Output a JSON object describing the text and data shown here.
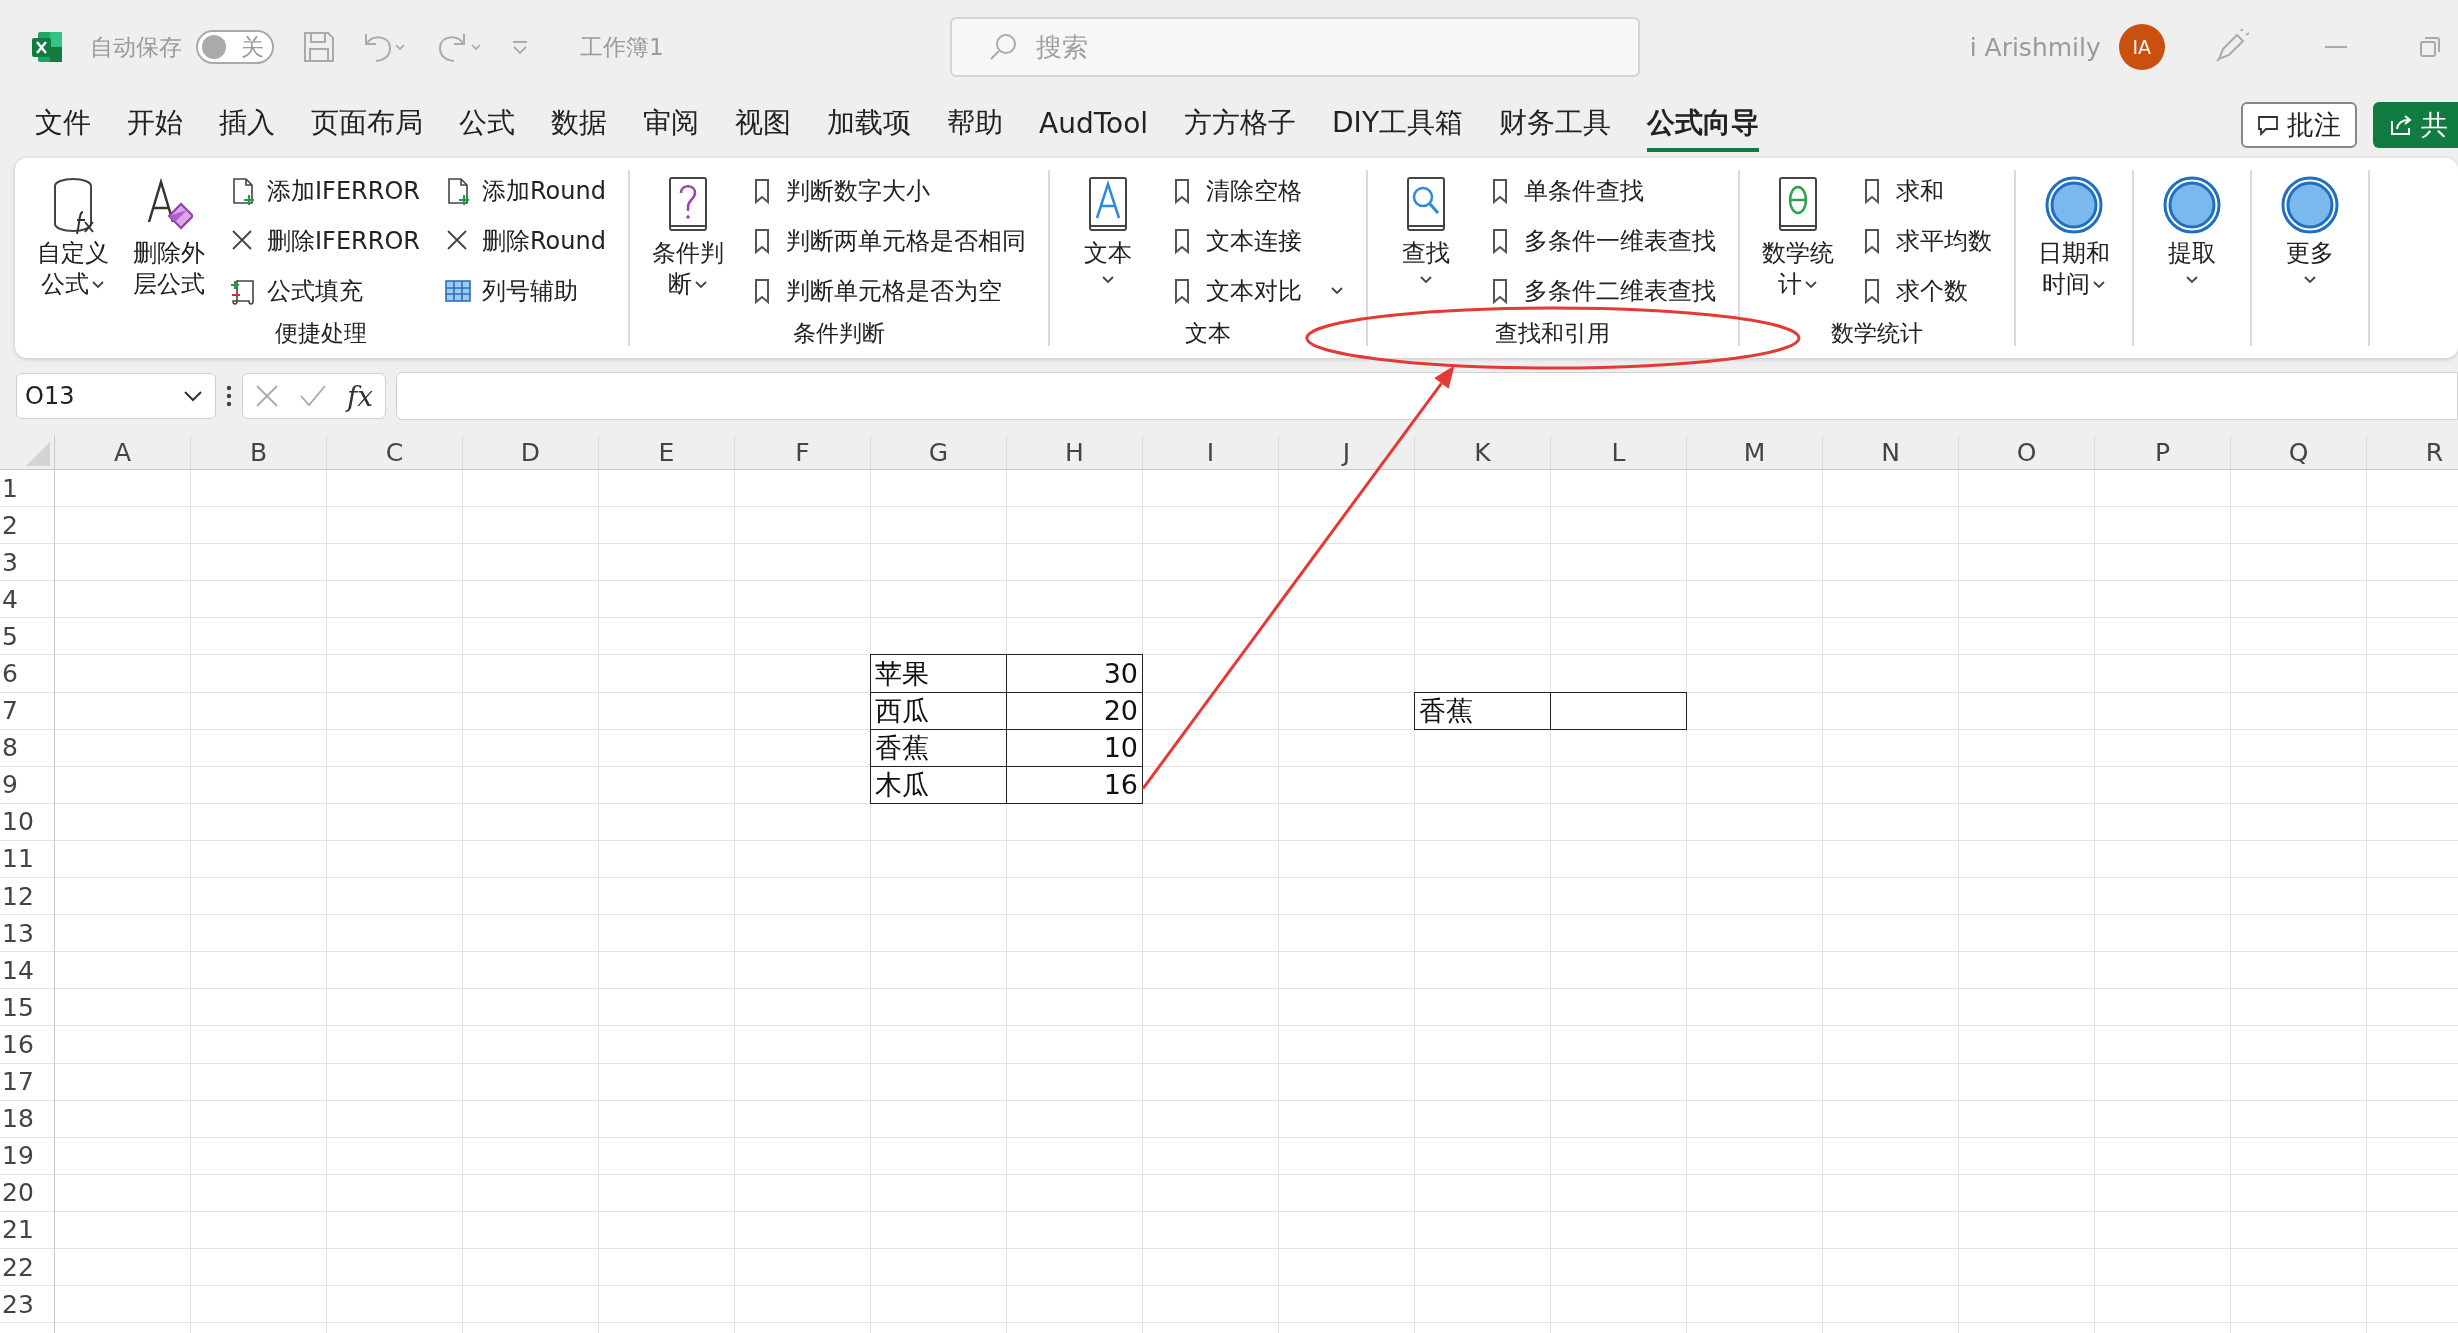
{
  "title_bar": {
    "autosave_label": "自动保存",
    "autosave": {
      "on": false,
      "text": "关"
    },
    "workbook": "工作簿1",
    "search_placeholder": "搜索",
    "user": "i Arishmily",
    "avatar": "IA"
  },
  "menu_tabs": [
    {
      "label": "文件",
      "selected": false
    },
    {
      "label": "开始",
      "selected": false
    },
    {
      "label": "插入",
      "selected": false
    },
    {
      "label": "页面布局",
      "selected": false
    },
    {
      "label": "公式",
      "selected": false
    },
    {
      "label": "数据",
      "selected": false
    },
    {
      "label": "审阅",
      "selected": false
    },
    {
      "label": "视图",
      "selected": false
    },
    {
      "label": "加载项",
      "selected": false
    },
    {
      "label": "帮助",
      "selected": false
    },
    {
      "label": "AudTool",
      "selected": false
    },
    {
      "label": "方方格子",
      "selected": false
    },
    {
      "label": "DIY工具箱",
      "selected": false
    },
    {
      "label": "财务工具",
      "selected": false
    },
    {
      "label": "公式向导",
      "selected": true
    }
  ],
  "comments_button": "批注",
  "share_button": "共",
  "ribbon": {
    "groups": [
      {
        "label": "便捷处理",
        "circled": false,
        "items": [
          {
            "kind": "large",
            "label": "自定义公式",
            "dropdown": true
          },
          {
            "kind": "large",
            "label": "删除外层公式",
            "dropdown": false
          },
          {
            "kind": "stack",
            "entries": [
              {
                "label": "添加IFERROR",
                "dropdown": false
              },
              {
                "label": "删除IFERROR",
                "dropdown": false
              },
              {
                "label": "公式填充",
                "dropdown": false
              }
            ]
          },
          {
            "kind": "stack",
            "entries": [
              {
                "label": "添加Round",
                "dropdown": false
              },
              {
                "label": "删除Round",
                "dropdown": false
              },
              {
                "label": "列号辅助",
                "dropdown": false
              }
            ]
          }
        ]
      },
      {
        "label": "条件判断",
        "circled": false,
        "items": [
          {
            "kind": "large",
            "label": "条件判断",
            "dropdown": true
          },
          {
            "kind": "stack",
            "entries": [
              {
                "label": "判断数字大小",
                "dropdown": false
              },
              {
                "label": "判断两单元格是否相同",
                "dropdown": false
              },
              {
                "label": "判断单元格是否为空",
                "dropdown": false
              }
            ]
          }
        ]
      },
      {
        "label": "文本",
        "circled": false,
        "items": [
          {
            "kind": "large",
            "label": "文本",
            "dropdown": true
          },
          {
            "kind": "stack",
            "entries": [
              {
                "label": "清除空格",
                "dropdown": false
              },
              {
                "label": "文本连接",
                "dropdown": false
              },
              {
                "label": "文本对比",
                "dropdown": true
              }
            ]
          }
        ]
      },
      {
        "label": "查找和引用",
        "circled": true,
        "items": [
          {
            "kind": "large",
            "label": "查找",
            "dropdown": true
          },
          {
            "kind": "stack",
            "entries": [
              {
                "label": "单条件查找",
                "dropdown": false
              },
              {
                "label": "多条件一维表查找",
                "dropdown": false
              },
              {
                "label": "多条件二维表查找",
                "dropdown": false
              }
            ]
          }
        ]
      },
      {
        "label": "数学统计",
        "circled": false,
        "items": [
          {
            "kind": "large",
            "label": "数学统计",
            "dropdown": true
          },
          {
            "kind": "stack",
            "entries": [
              {
                "label": "求和",
                "dropdown": false
              },
              {
                "label": "求平均数",
                "dropdown": false
              },
              {
                "label": "求个数",
                "dropdown": false
              }
            ]
          }
        ]
      },
      {
        "circled": false,
        "items": [
          {
            "kind": "large",
            "label": "日期和时间",
            "dropdown": true
          }
        ]
      },
      {
        "circled": false,
        "items": [
          {
            "kind": "large",
            "label": "提取",
            "dropdown": true
          }
        ]
      },
      {
        "circled": false,
        "items": [
          {
            "kind": "large",
            "label": "更多",
            "dropdown": true
          }
        ]
      }
    ]
  },
  "formula_bar": {
    "name_box": "O13",
    "function_label": "fx"
  },
  "pointer_arrow": true,
  "sheet": {
    "columns": [
      "A",
      "B",
      "C",
      "D",
      "E",
      "F",
      "G",
      "H",
      "I",
      "J",
      "K",
      "L",
      "M",
      "N",
      "O",
      "P",
      "Q",
      "R"
    ],
    "rows": [
      {
        "header": "1"
      },
      {
        "header": "2"
      },
      {
        "header": "3"
      },
      {
        "header": "4"
      },
      {
        "header": "5"
      },
      {
        "header": "6",
        "cells": [
          null,
          null,
          null,
          null,
          null,
          null,
          {
            "text": "苹果",
            "kind": "text",
            "bordered": true
          },
          {
            "text": "30",
            "kind": "number",
            "bordered": true
          }
        ]
      },
      {
        "header": "7",
        "cells": [
          null,
          null,
          null,
          null,
          null,
          null,
          {
            "text": "西瓜",
            "kind": "text",
            "bordered": true
          },
          {
            "text": "20",
            "kind": "number",
            "bordered": true
          },
          null,
          null,
          {
            "text": "香蕉",
            "kind": "text",
            "bordered": true
          },
          {
            "bordered": true
          }
        ]
      },
      {
        "header": "8",
        "cells": [
          null,
          null,
          null,
          null,
          null,
          null,
          {
            "text": "香蕉",
            "kind": "text",
            "bordered": true
          },
          {
            "text": "10",
            "kind": "number",
            "bordered": true
          }
        ]
      },
      {
        "header": "9",
        "cells": [
          null,
          null,
          null,
          null,
          null,
          null,
          {
            "text": "木瓜",
            "kind": "text",
            "bordered": true
          },
          {
            "text": "16",
            "kind": "number",
            "bordered": true
          }
        ]
      },
      {
        "header": "10"
      },
      {
        "header": "11"
      },
      {
        "header": "12"
      },
      {
        "header": "13"
      },
      {
        "header": "14"
      },
      {
        "header": "15"
      },
      {
        "header": "16"
      },
      {
        "header": "17"
      },
      {
        "header": "18"
      },
      {
        "header": "19"
      },
      {
        "header": "20"
      },
      {
        "header": "21"
      },
      {
        "header": "22"
      },
      {
        "header": "23"
      }
    ]
  }
}
